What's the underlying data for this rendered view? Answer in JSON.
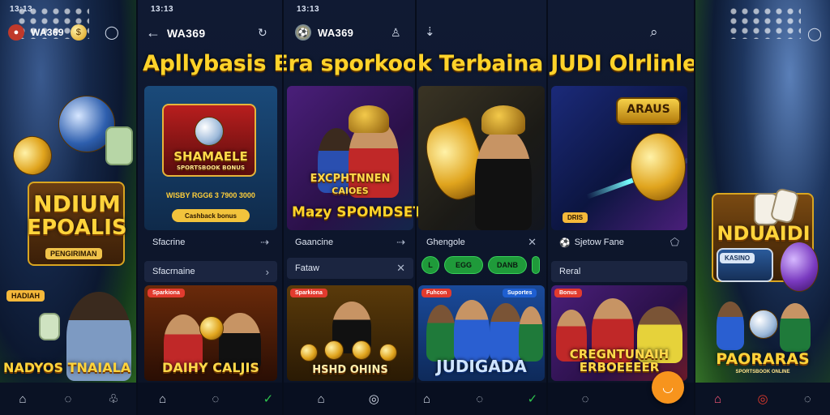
{
  "left_panel": {
    "status_time": "13:13",
    "brand": "WA369",
    "art_title_line1": "NDIUM",
    "art_title_line2": "EPOALIS",
    "art_plate": "PENGIRIMAN",
    "small_badge": "HADIAH",
    "footer_title": "NADYOS TNAIALA"
  },
  "right_panel": {
    "art_title": "NDUAIDI",
    "plate_text": "KASINO",
    "footer_title": "PAORARAS",
    "footer_sub": "SPORTSBOOK ONLINE"
  },
  "app": {
    "status_time_1": "13:13",
    "status_time_2": "13:13",
    "brand_1": "WA369",
    "brand_2": "WA369",
    "headline": "Apllybasis Era sporkook Terbaina JUDI Olrlinle!",
    "cards": [
      {
        "title": "SHAMAELE",
        "subtitle": "SPORTSBOOK BONUS",
        "bonus_line": "WISBY RGG6 3 7900 3000",
        "button": "Cashback bonus",
        "row1": "Sfacrine",
        "row2": "Sfacrnaine"
      },
      {
        "title": "EXCPHTNNEN",
        "subtitle": "CAIOES",
        "banner": "Mazy SPOMDSETSIASDOK",
        "row1": "Gaancine",
        "row2": "Fataw"
      },
      {
        "row1": "Ghengole",
        "pills": [
          "L",
          "EGG",
          "DANB",
          ""
        ]
      },
      {
        "title": "ARAUS",
        "badge": "DRIS",
        "row1": "Sjetow Fane",
        "row2": "Reral"
      }
    ],
    "lower_cards": [
      {
        "tag": "Sparkiona",
        "title": "DAIHY CALJIS"
      },
      {
        "tag": "Sparkiona",
        "title": "HSHD OHINS"
      },
      {
        "tag": "Fuhcon",
        "corner_tag": "Suportes",
        "title": "JUDIGADA"
      },
      {
        "corner_tag": "Bonus",
        "title": "CREGNTUNAIH",
        "title2": "ERBOEEEER"
      }
    ]
  },
  "icons": {
    "back": "arrow-left-icon",
    "refresh": "refresh-icon",
    "search": "search-icon",
    "home": "home-icon",
    "chat": "chat-icon"
  },
  "colors": {
    "headline": "#ffd32a",
    "pill_green": "#1f9a3a",
    "fab_orange": "#f7941d"
  }
}
